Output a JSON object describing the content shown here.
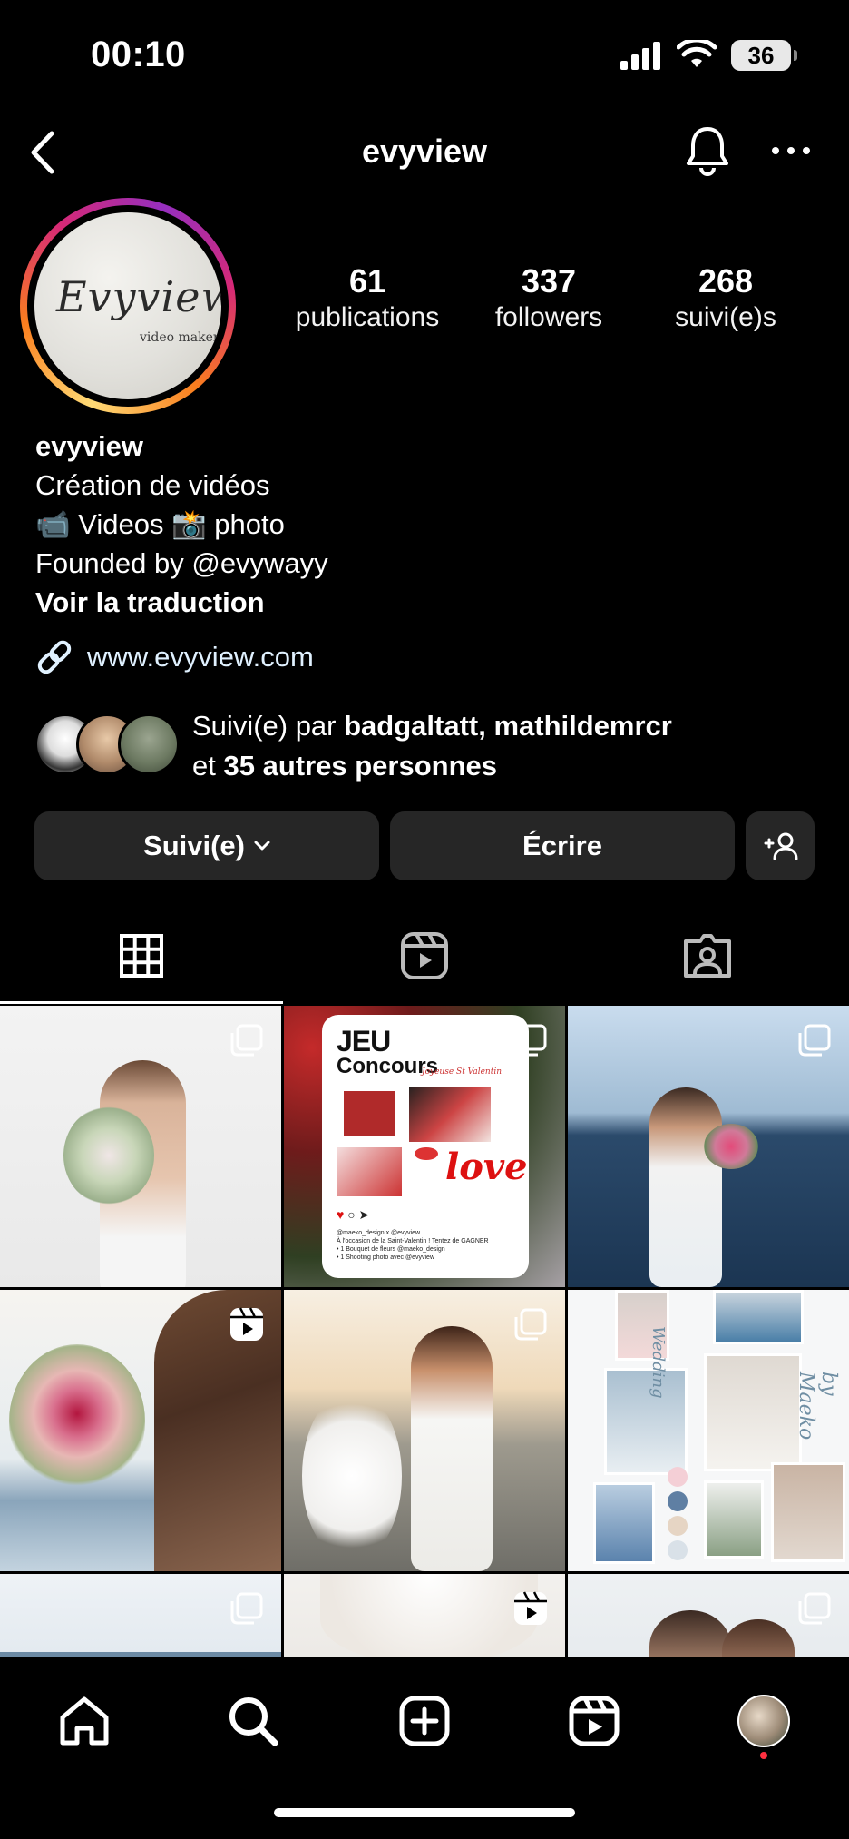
{
  "status_bar": {
    "time": "00:10",
    "battery": "36"
  },
  "header": {
    "title": "evyview"
  },
  "avatar": {
    "logo_text": "Evyview",
    "logo_sub": "video maker"
  },
  "stats": [
    {
      "value": "61",
      "label": "publications"
    },
    {
      "value": "337",
      "label": "followers"
    },
    {
      "value": "268",
      "label": "suivi(e)s"
    }
  ],
  "bio": {
    "name": "evyview",
    "line1": "Création de vidéos",
    "line2": "📹 Videos 📸 photo",
    "line3": "Founded by @evywayy",
    "translate": "Voir la traduction",
    "link": "www.evyview.com"
  },
  "followed_by": {
    "prefix": "Suivi(e) par",
    "names": "badgaltatt, mathildemrcr",
    "mid": "et",
    "others": "35 autres personnes"
  },
  "actions": {
    "follow_label": "Suivi(e)",
    "message_label": "Écrire"
  },
  "grid": {
    "contest_title1": "JEU",
    "contest_title2": "Concours",
    "contest_subtitle": "Joyeuse St Valentin",
    "contest_body1": "@maeko_design x @evyview",
    "contest_body2": "À l'occasion de la Saint-Valentin ! Tentez de GAGNER",
    "contest_body3": "• 1 Bouquet de fleurs @maeko_design",
    "contest_body4": "• 1 Shooting photo avec @evyview",
    "contest_love": "love",
    "moodboard_text1": "Wedding",
    "moodboard_text2": "by Maeko"
  },
  "colors": {
    "background": "#000000",
    "button": "#262626",
    "notification_dot": "#ff3040"
  }
}
